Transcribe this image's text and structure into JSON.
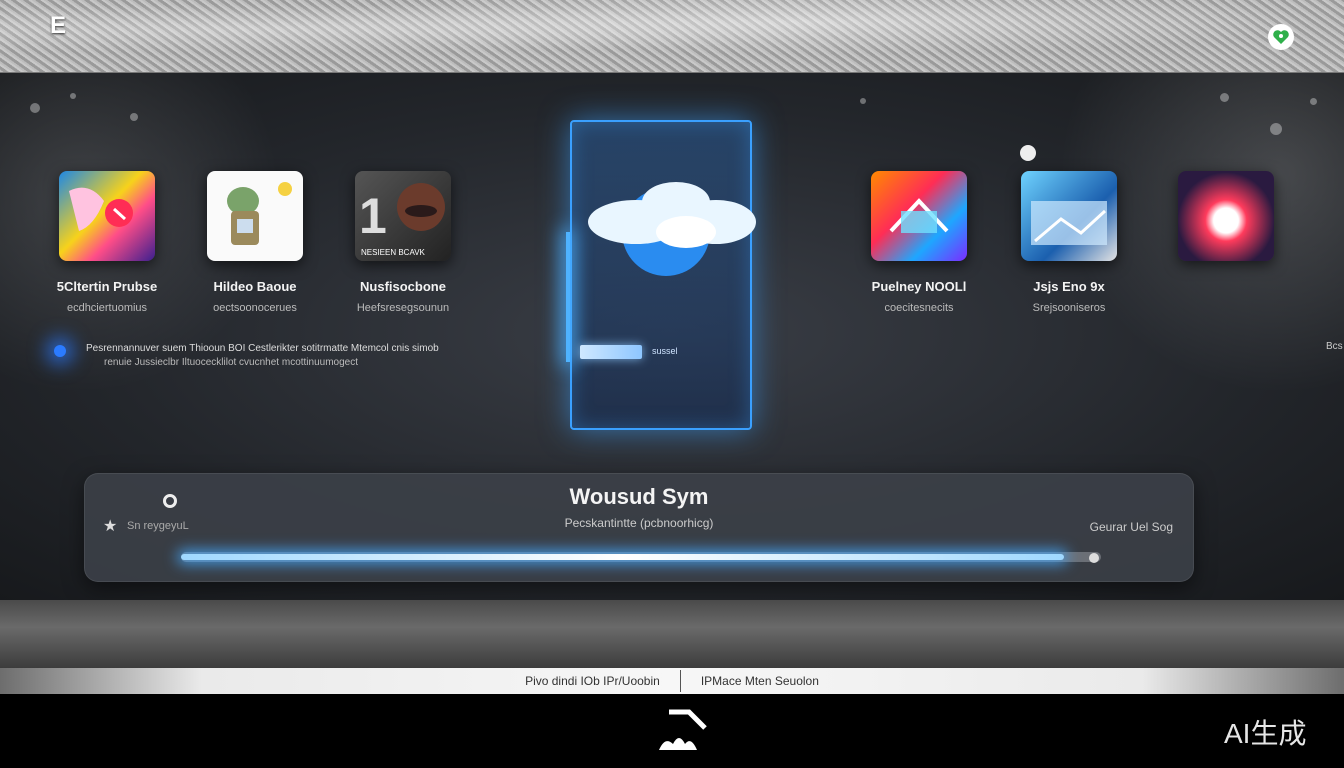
{
  "header": {
    "logo": "E",
    "badge_icon": "heart-icon"
  },
  "apps": [
    {
      "name": "5Cltertin Prubse",
      "sub": "ecdhciertuomius"
    },
    {
      "name": "Hildeo Baoue",
      "sub": "oectsoonocerues"
    },
    {
      "name": "Nusfisocbone",
      "sub": "Heefsresegsounun",
      "tile_text": "NESIEEN BCAVK"
    },
    {
      "name": "Puelney NOOLl",
      "sub": "coecitesnecits"
    },
    {
      "name": "Jsjs Eno   9x",
      "sub": "Srejsooniseros"
    },
    {
      "name": "",
      "sub": ""
    }
  ],
  "notice": {
    "line1": "Pesrennannuver suem Thiooun BOI Cestlerikter sotitrmatte Mtemcol cnis simob",
    "line2": "renuie Jussieclbr Iltuocecklilot   cvucnhet mcottinuumogect"
  },
  "edge_label": "Bcs",
  "center_card": {
    "input_label": "sussel"
  },
  "player": {
    "title": "Wousud Sym",
    "subtitle": "Pecskantintte (pcbnoorhicg)",
    "left_label": "Sn reygeyuL",
    "right_label": "Geurar Uel Sog",
    "progress": 0.96
  },
  "status": {
    "left": "Pivo dindi IOb IPr/Uoobin",
    "right": "IPMace Mten Seuolon"
  },
  "watermark": "AI生成"
}
